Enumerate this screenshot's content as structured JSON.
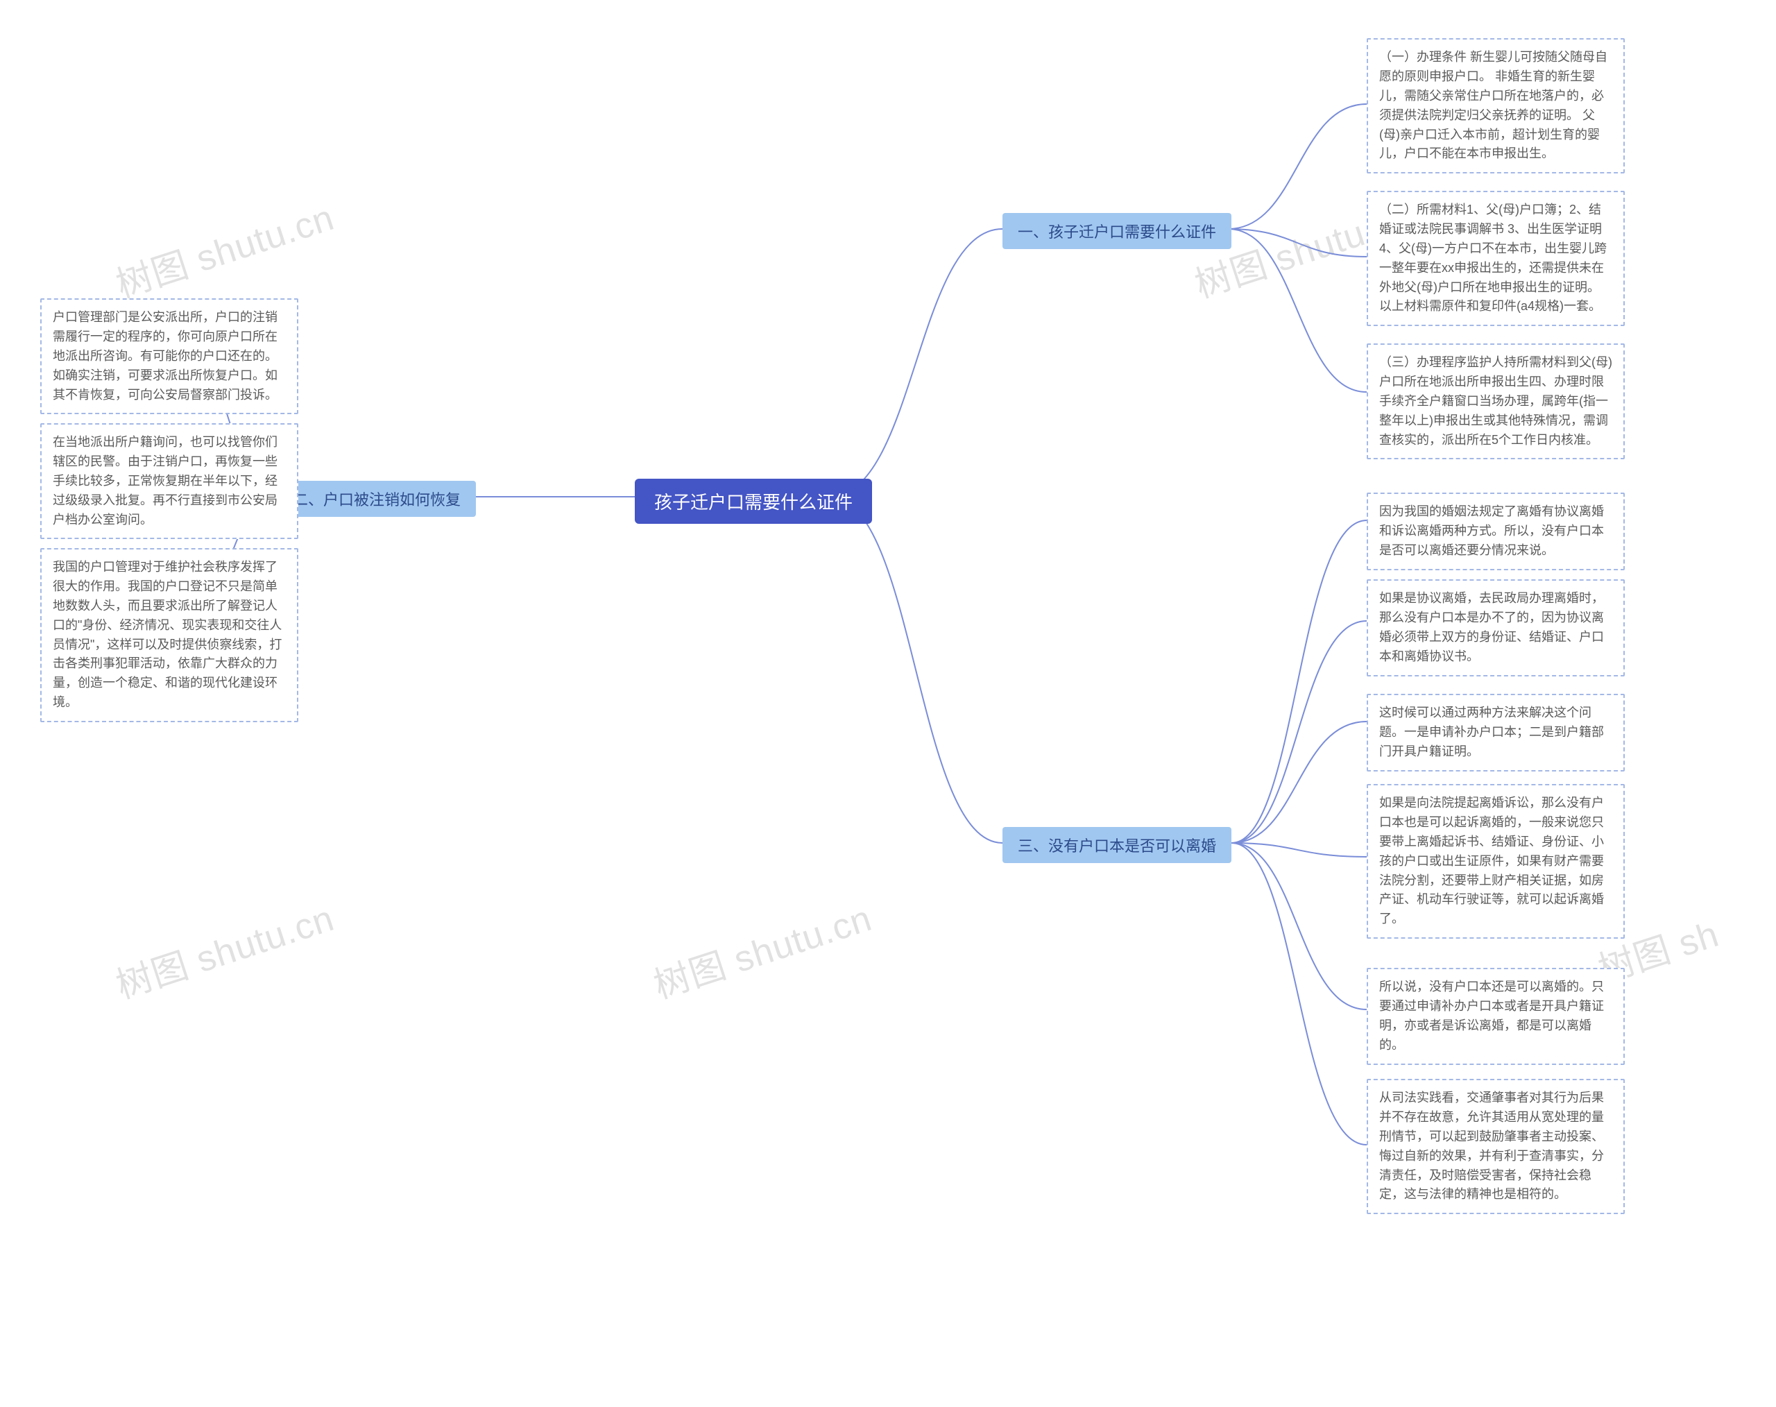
{
  "root": {
    "title": "孩子迁户口需要什么证件"
  },
  "branches": {
    "b1": {
      "label": "一、孩子迁户口需要什么证件"
    },
    "b2": {
      "label": "二、户口被注销如何恢复"
    },
    "b3": {
      "label": "三、没有户口本是否可以离婚"
    }
  },
  "leaves": {
    "b1_1": "（一）办理条件 新生婴儿可按随父随母自愿的原则申报户口。 非婚生育的新生婴儿，需随父亲常住户口所在地落户的，必须提供法院判定归父亲抚养的证明。 父(母)亲户口迁入本市前，超计划生育的婴儿，户口不能在本市申报出生。",
    "b1_2": "（二）所需材料1、父(母)户口簿；2、结婚证或法院民事调解书 3、出生医学证明 4、父(母)一方户口不在本市，出生婴儿跨一整年要在xx申报出生的，还需提供未在外地父(母)户口所在地申报出生的证明。 以上材料需原件和复印件(a4规格)一套。",
    "b1_3": "（三）办理程序监护人持所需材料到父(母)户口所在地派出所申报出生四、办理时限手续齐全户籍窗口当场办理，属跨年(指一整年以上)申报出生或其他特殊情况，需调查核实的，派出所在5个工作日内核准。",
    "b2_1": "户口管理部门是公安派出所，户口的注销需履行一定的程序的，你可向原户口所在地派出所咨询。有可能你的户口还在的。如确实注销，可要求派出所恢复户口。如其不肯恢复，可向公安局督察部门投诉。",
    "b2_2": "在当地派出所户籍询问，也可以找管你们辖区的民警。由于注销户口，再恢复一些手续比较多，正常恢复期在半年以下，经过级级录入批复。再不行直接到市公安局户档办公室询问。",
    "b2_3": "我国的户口管理对于维护社会秩序发挥了很大的作用。我国的户口登记不只是简单地数数人头，而且要求派出所了解登记人口的\"身份、经济情况、现实表现和交往人员情况\"，这样可以及时提供侦察线索，打击各类刑事犯罪活动，依靠广大群众的力量，创造一个稳定、和谐的现代化建设环境。",
    "b3_1": "因为我国的婚姻法规定了离婚有协议离婚和诉讼离婚两种方式。所以，没有户口本是否可以离婚还要分情况来说。",
    "b3_2": "如果是协议离婚，去民政局办理离婚时，那么没有户口本是办不了的，因为协议离婚必须带上双方的身份证、结婚证、户口本和离婚协议书。",
    "b3_3": "这时候可以通过两种方法来解决这个问题。一是申请补办户口本；二是到户籍部门开具户籍证明。",
    "b3_4": "如果是向法院提起离婚诉讼，那么没有户口本也是可以起诉离婚的，一般来说您只要带上离婚起诉书、结婚证、身份证、小孩的户口或出生证原件，如果有财产需要法院分割，还要带上财产相关证据，如房产证、机动车行驶证等，就可以起诉离婚了。",
    "b3_5": "所以说，没有户口本还是可以离婚的。只要通过申请补办户口本或者是开具户籍证明，亦或者是诉讼离婚，都是可以离婚的。",
    "b3_6": "从司法实践看，交通肇事者对其行为后果并不存在故意，允许其适用从宽处理的量刑情节，可以起到鼓励肇事者主动投案、悔过自新的效果，并有利于查清事实，分清责任，及时赔偿受害者，保持社会稳定，这与法律的精神也是相符的。"
  },
  "watermarks": [
    "树图 shutu.cn",
    "树图 shutu.cn",
    "树图 shutu.cn",
    "树图 sh",
    "树图 shutu.cn"
  ]
}
